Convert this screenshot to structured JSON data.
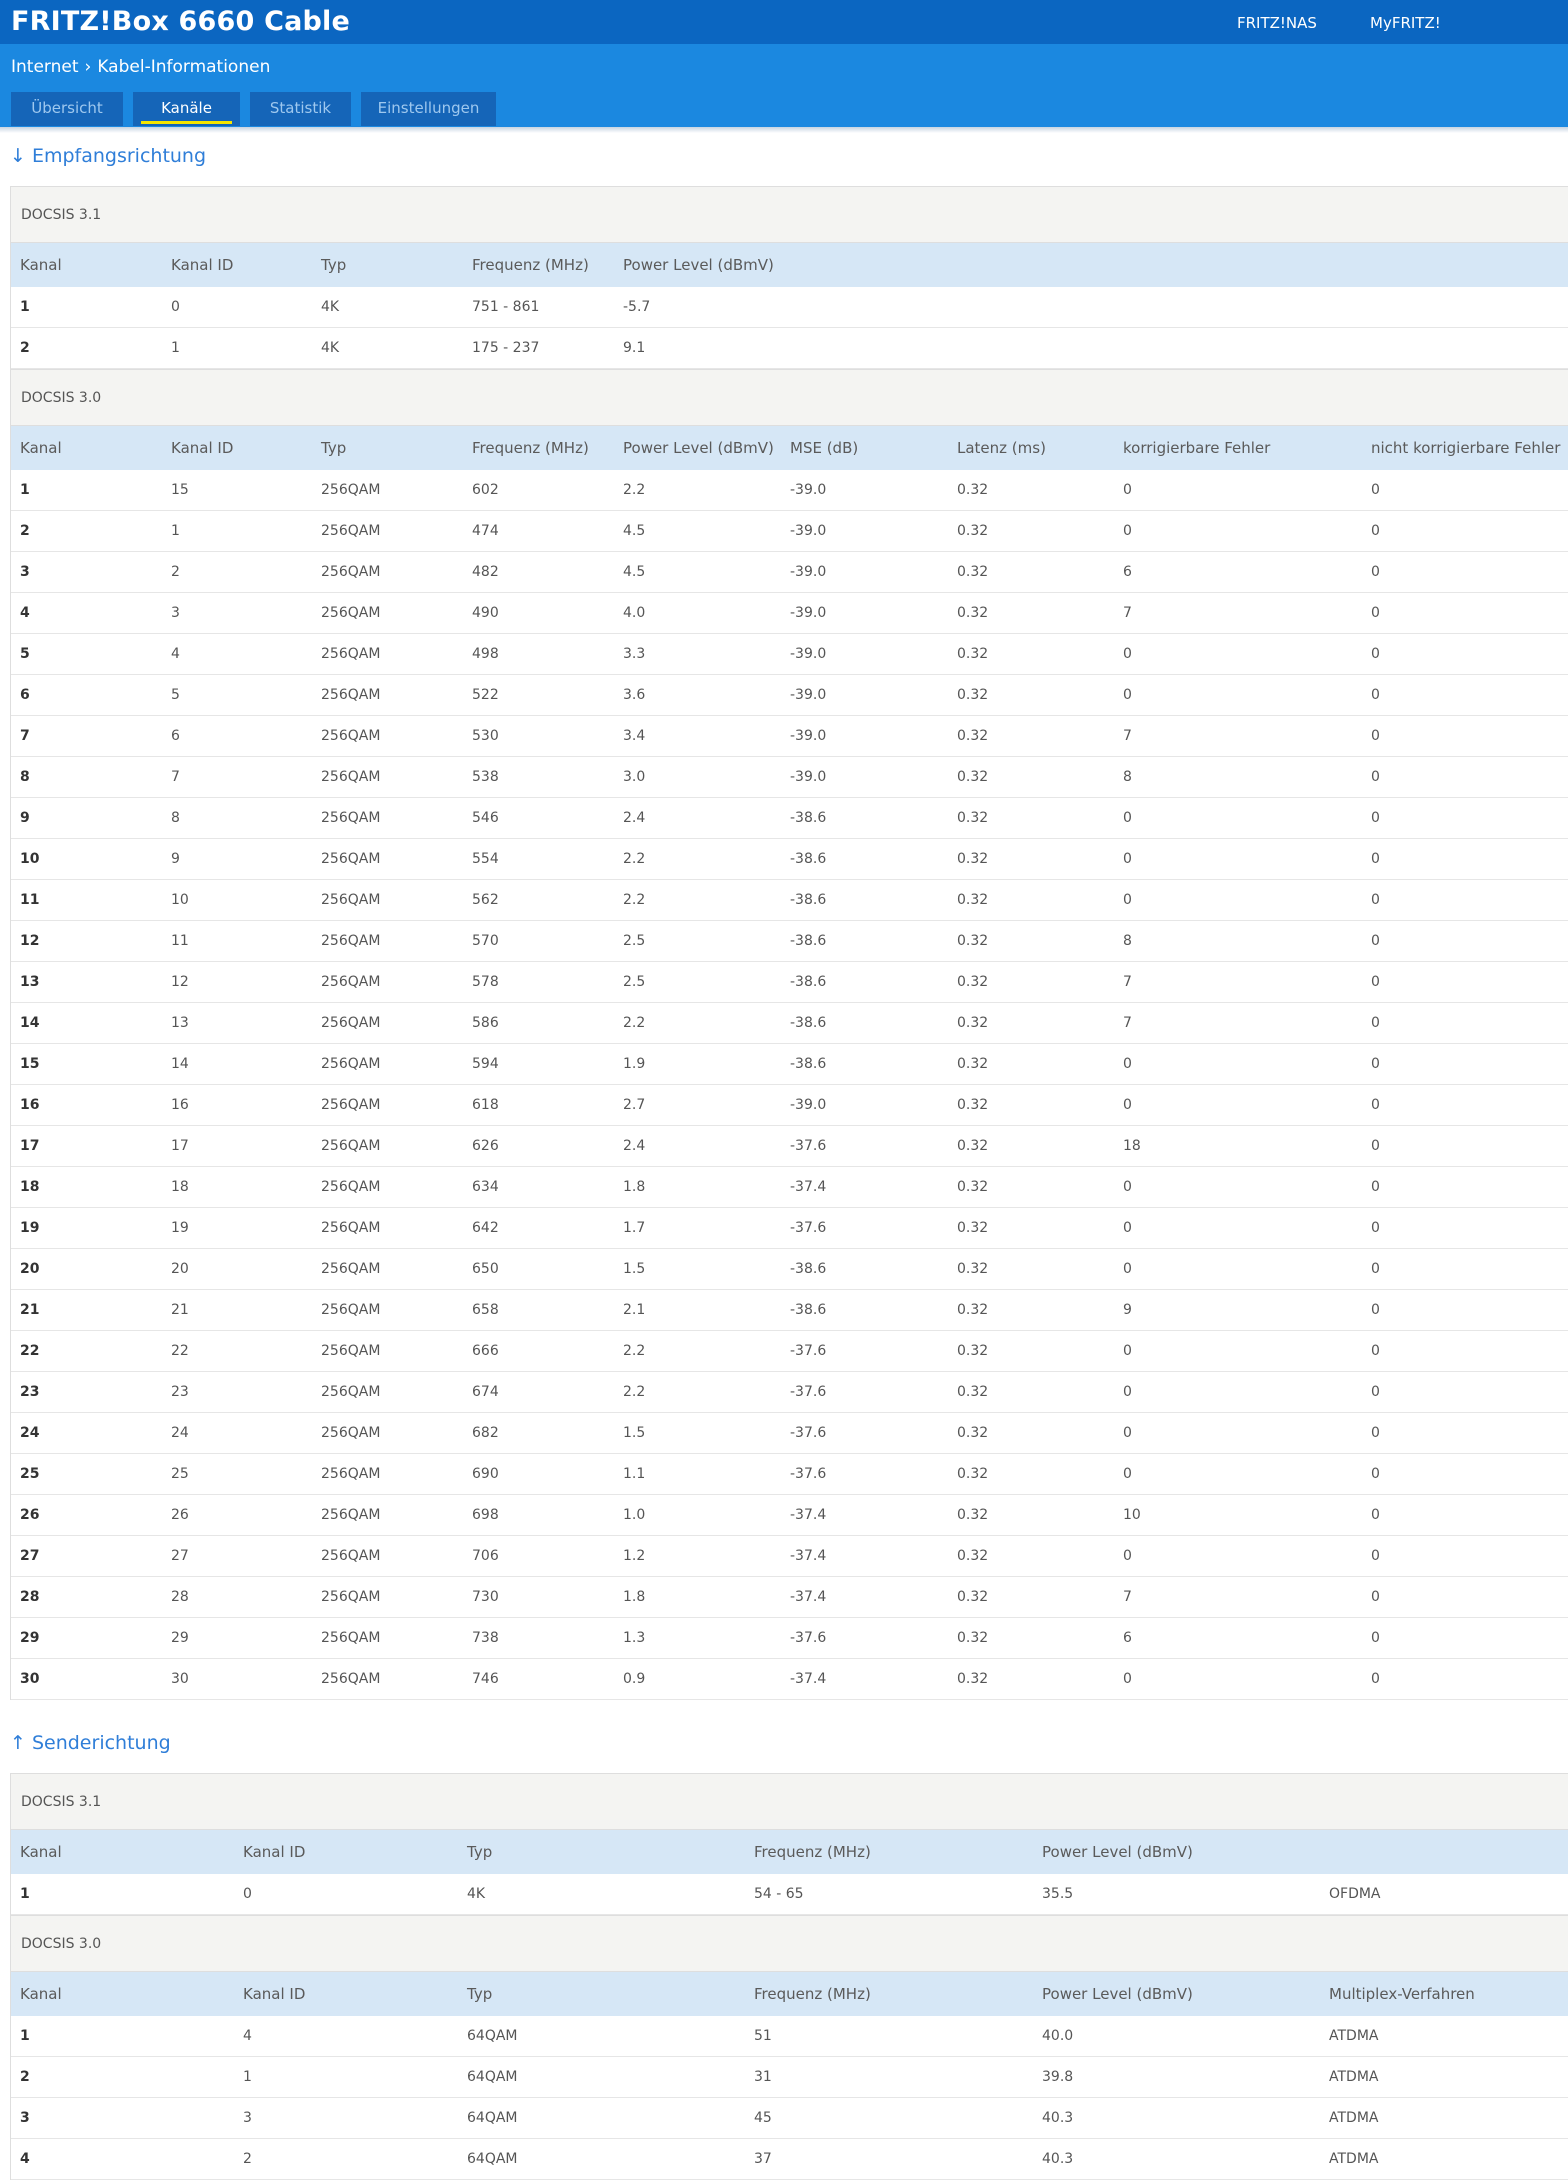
{
  "app": {
    "title": "FRITZ!Box 6660 Cable",
    "links": [
      "FRITZ!NAS",
      "MyFRITZ!"
    ]
  },
  "breadcrumb": [
    "Internet",
    "Kabel-Informationen"
  ],
  "tabs": [
    {
      "label": "Übersicht",
      "active": false
    },
    {
      "label": "Kanäle",
      "active": true
    },
    {
      "label": "Statistik",
      "active": false
    },
    {
      "label": "Einstellungen",
      "active": false
    }
  ],
  "downstream": {
    "title": "↓ Empfangsrichtung",
    "docsis31": {
      "label": "DOCSIS 3.1",
      "headers": [
        "Kanal",
        "Kanal ID",
        "Typ",
        "Frequenz (MHz)",
        "Power Level (dBmV)"
      ],
      "rows": [
        [
          "1",
          "0",
          "4K",
          "751 - 861",
          "-5.7"
        ],
        [
          "2",
          "1",
          "4K",
          "175 - 237",
          "9.1"
        ]
      ]
    },
    "docsis30": {
      "label": "DOCSIS 3.0",
      "headers": [
        "Kanal",
        "Kanal ID",
        "Typ",
        "Frequenz (MHz)",
        "Power Level (dBmV)",
        "MSE (dB)",
        "Latenz (ms)",
        "korrigierbare Fehler",
        "nicht korrigierbare Fehler"
      ],
      "rows": [
        [
          "1",
          "15",
          "256QAM",
          "602",
          "2.2",
          "-39.0",
          "0.32",
          "0",
          "0"
        ],
        [
          "2",
          "1",
          "256QAM",
          "474",
          "4.5",
          "-39.0",
          "0.32",
          "0",
          "0"
        ],
        [
          "3",
          "2",
          "256QAM",
          "482",
          "4.5",
          "-39.0",
          "0.32",
          "6",
          "0"
        ],
        [
          "4",
          "3",
          "256QAM",
          "490",
          "4.0",
          "-39.0",
          "0.32",
          "7",
          "0"
        ],
        [
          "5",
          "4",
          "256QAM",
          "498",
          "3.3",
          "-39.0",
          "0.32",
          "0",
          "0"
        ],
        [
          "6",
          "5",
          "256QAM",
          "522",
          "3.6",
          "-39.0",
          "0.32",
          "0",
          "0"
        ],
        [
          "7",
          "6",
          "256QAM",
          "530",
          "3.4",
          "-39.0",
          "0.32",
          "7",
          "0"
        ],
        [
          "8",
          "7",
          "256QAM",
          "538",
          "3.0",
          "-39.0",
          "0.32",
          "8",
          "0"
        ],
        [
          "9",
          "8",
          "256QAM",
          "546",
          "2.4",
          "-38.6",
          "0.32",
          "0",
          "0"
        ],
        [
          "10",
          "9",
          "256QAM",
          "554",
          "2.2",
          "-38.6",
          "0.32",
          "0",
          "0"
        ],
        [
          "11",
          "10",
          "256QAM",
          "562",
          "2.2",
          "-38.6",
          "0.32",
          "0",
          "0"
        ],
        [
          "12",
          "11",
          "256QAM",
          "570",
          "2.5",
          "-38.6",
          "0.32",
          "8",
          "0"
        ],
        [
          "13",
          "12",
          "256QAM",
          "578",
          "2.5",
          "-38.6",
          "0.32",
          "7",
          "0"
        ],
        [
          "14",
          "13",
          "256QAM",
          "586",
          "2.2",
          "-38.6",
          "0.32",
          "7",
          "0"
        ],
        [
          "15",
          "14",
          "256QAM",
          "594",
          "1.9",
          "-38.6",
          "0.32",
          "0",
          "0"
        ],
        [
          "16",
          "16",
          "256QAM",
          "618",
          "2.7",
          "-39.0",
          "0.32",
          "0",
          "0"
        ],
        [
          "17",
          "17",
          "256QAM",
          "626",
          "2.4",
          "-37.6",
          "0.32",
          "18",
          "0"
        ],
        [
          "18",
          "18",
          "256QAM",
          "634",
          "1.8",
          "-37.4",
          "0.32",
          "0",
          "0"
        ],
        [
          "19",
          "19",
          "256QAM",
          "642",
          "1.7",
          "-37.6",
          "0.32",
          "0",
          "0"
        ],
        [
          "20",
          "20",
          "256QAM",
          "650",
          "1.5",
          "-38.6",
          "0.32",
          "0",
          "0"
        ],
        [
          "21",
          "21",
          "256QAM",
          "658",
          "2.1",
          "-38.6",
          "0.32",
          "9",
          "0"
        ],
        [
          "22",
          "22",
          "256QAM",
          "666",
          "2.2",
          "-37.6",
          "0.32",
          "0",
          "0"
        ],
        [
          "23",
          "23",
          "256QAM",
          "674",
          "2.2",
          "-37.6",
          "0.32",
          "0",
          "0"
        ],
        [
          "24",
          "24",
          "256QAM",
          "682",
          "1.5",
          "-37.6",
          "0.32",
          "0",
          "0"
        ],
        [
          "25",
          "25",
          "256QAM",
          "690",
          "1.1",
          "-37.6",
          "0.32",
          "0",
          "0"
        ],
        [
          "26",
          "26",
          "256QAM",
          "698",
          "1.0",
          "-37.4",
          "0.32",
          "10",
          "0"
        ],
        [
          "27",
          "27",
          "256QAM",
          "706",
          "1.2",
          "-37.4",
          "0.32",
          "0",
          "0"
        ],
        [
          "28",
          "28",
          "256QAM",
          "730",
          "1.8",
          "-37.4",
          "0.32",
          "7",
          "0"
        ],
        [
          "29",
          "29",
          "256QAM",
          "738",
          "1.3",
          "-37.6",
          "0.32",
          "6",
          "0"
        ],
        [
          "30",
          "30",
          "256QAM",
          "746",
          "0.9",
          "-37.4",
          "0.32",
          "0",
          "0"
        ]
      ]
    }
  },
  "upstream": {
    "title": "↑ Senderichtung",
    "docsis31": {
      "label": "DOCSIS 3.1",
      "headers": [
        "Kanal",
        "Kanal ID",
        "Typ",
        "Frequenz (MHz)",
        "Power Level (dBmV)",
        ""
      ],
      "rows": [
        [
          "1",
          "0",
          "4K",
          "54 - 65",
          "35.5",
          "OFDMA"
        ]
      ]
    },
    "docsis30": {
      "label": "DOCSIS 3.0",
      "headers": [
        "Kanal",
        "Kanal ID",
        "Typ",
        "Frequenz (MHz)",
        "Power Level (dBmV)",
        "Multiplex-Verfahren"
      ],
      "rows": [
        [
          "1",
          "4",
          "64QAM",
          "51",
          "40.0",
          "ATDMA"
        ],
        [
          "2",
          "1",
          "64QAM",
          "31",
          "39.8",
          "ATDMA"
        ],
        [
          "3",
          "3",
          "64QAM",
          "45",
          "40.3",
          "ATDMA"
        ],
        [
          "4",
          "2",
          "64QAM",
          "37",
          "40.3",
          "ATDMA"
        ]
      ]
    }
  }
}
